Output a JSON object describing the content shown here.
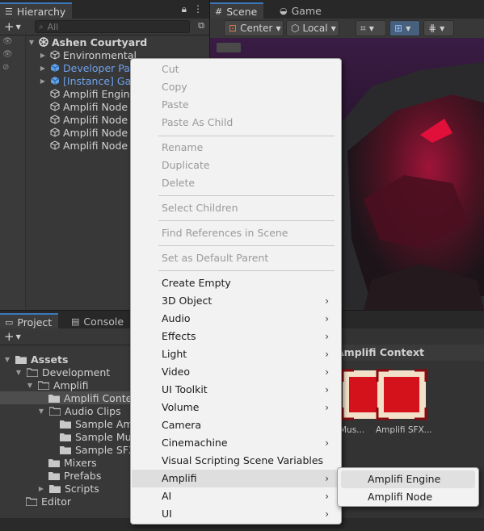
{
  "hierarchy": {
    "tab_label": "Hierarchy",
    "search_placeholder": "All",
    "scene_name": "Ashen Courtyard",
    "items": [
      {
        "label": "Environmental"
      },
      {
        "label": "Developer Panel"
      },
      {
        "label": "[Instance] Game"
      },
      {
        "label": "Amplifi Engine"
      },
      {
        "label": "Amplifi Node (2)"
      },
      {
        "label": "Amplifi Node (5)"
      },
      {
        "label": "Amplifi Node (6)"
      },
      {
        "label": "Amplifi Node"
      }
    ]
  },
  "scene": {
    "tabs": [
      {
        "label": "Scene"
      },
      {
        "label": "Game"
      }
    ],
    "pivot_label": "Center",
    "space_label": "Local"
  },
  "project": {
    "tabs": [
      {
        "label": "Project"
      },
      {
        "label": "Console"
      }
    ],
    "tree": [
      {
        "label": "Assets"
      },
      {
        "label": "Development"
      },
      {
        "label": "Amplifi"
      },
      {
        "label": "Amplifi Context"
      },
      {
        "label": "Audio Clips"
      },
      {
        "label": "Sample Amb"
      },
      {
        "label": "Sample Musi"
      },
      {
        "label": "Sample SFX"
      },
      {
        "label": "Mixers"
      },
      {
        "label": "Prefabs"
      },
      {
        "label": "Scripts"
      },
      {
        "label": "Editor"
      }
    ],
    "breadcrumb": "Amplifi Context",
    "assets": [
      {
        "label": "Mus..."
      },
      {
        "label": "Amplifi SFX..."
      }
    ]
  },
  "context_menu": {
    "groups": [
      [
        {
          "label": "Cut"
        },
        {
          "label": "Copy"
        },
        {
          "label": "Paste"
        },
        {
          "label": "Paste As Child"
        }
      ],
      [
        {
          "label": "Rename"
        },
        {
          "label": "Duplicate"
        },
        {
          "label": "Delete"
        }
      ],
      [
        {
          "label": "Select Children"
        }
      ],
      [
        {
          "label": "Find References in Scene"
        }
      ],
      [
        {
          "label": "Set as Default Parent"
        }
      ]
    ],
    "items": [
      {
        "label": "Create Empty"
      },
      {
        "label": "3D Object"
      },
      {
        "label": "Audio"
      },
      {
        "label": "Effects"
      },
      {
        "label": "Light"
      },
      {
        "label": "Video"
      },
      {
        "label": "UI Toolkit"
      },
      {
        "label": "Volume"
      },
      {
        "label": "Camera"
      },
      {
        "label": "Cinemachine"
      },
      {
        "label": "Visual Scripting Scene Variables"
      },
      {
        "label": "Amplifi"
      },
      {
        "label": "AI"
      },
      {
        "label": "UI"
      }
    ]
  },
  "submenu": {
    "items": [
      {
        "label": "Amplifi Engine"
      },
      {
        "label": "Amplifi Node"
      }
    ]
  },
  "colors": {
    "accent": "#3a79bb",
    "prefab_blue": "#6ea2ea",
    "menu_bg": "#f2f2f2",
    "asset_red": "#d4121c"
  }
}
